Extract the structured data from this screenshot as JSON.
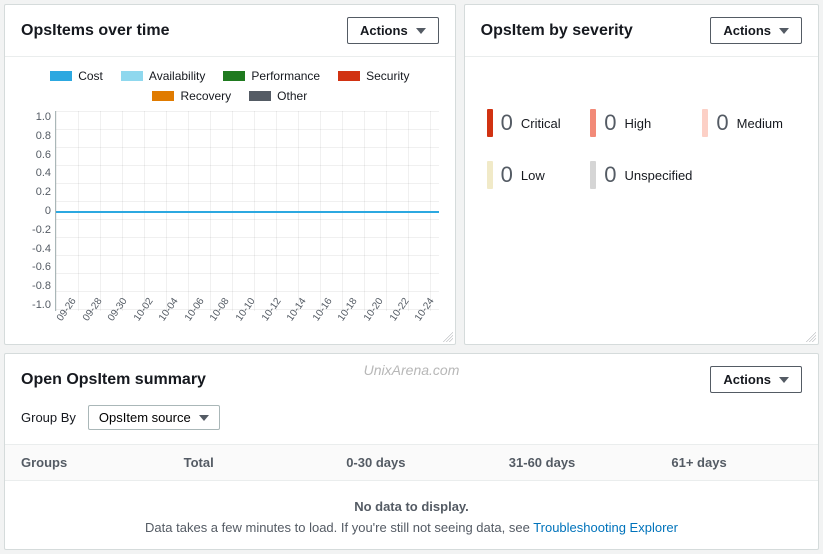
{
  "actions_label": "Actions",
  "watermark": "UnixArena.com",
  "chart_panel": {
    "title": "OpsItems over time",
    "legend": [
      {
        "label": "Cost",
        "color": "#2ca8e0"
      },
      {
        "label": "Availability",
        "color": "#8fd8ee"
      },
      {
        "label": "Performance",
        "color": "#1f7a1f"
      },
      {
        "label": "Security",
        "color": "#d13212"
      },
      {
        "label": "Recovery",
        "color": "#e07b00"
      },
      {
        "label": "Other",
        "color": "#545b64"
      }
    ]
  },
  "chart_data": {
    "type": "line",
    "title": "OpsItems over time",
    "xlabel": "",
    "ylabel": "",
    "ylim": [
      -1.0,
      1.0
    ],
    "y_ticks": [
      "1.0",
      "0.8",
      "0.6",
      "0.4",
      "0.2",
      "0",
      "-0.2",
      "-0.4",
      "-0.6",
      "-0.8",
      "-1.0"
    ],
    "categories": [
      "09-26",
      "09-28",
      "09-30",
      "10-02",
      "10-04",
      "10-06",
      "10-08",
      "10-10",
      "10-12",
      "10-14",
      "10-16",
      "10-18",
      "10-20",
      "10-22",
      "10-24"
    ],
    "series": [
      {
        "name": "Cost",
        "values": [
          0,
          0,
          0,
          0,
          0,
          0,
          0,
          0,
          0,
          0,
          0,
          0,
          0,
          0,
          0
        ]
      },
      {
        "name": "Availability",
        "values": [
          0,
          0,
          0,
          0,
          0,
          0,
          0,
          0,
          0,
          0,
          0,
          0,
          0,
          0,
          0
        ]
      },
      {
        "name": "Performance",
        "values": [
          0,
          0,
          0,
          0,
          0,
          0,
          0,
          0,
          0,
          0,
          0,
          0,
          0,
          0,
          0
        ]
      },
      {
        "name": "Security",
        "values": [
          0,
          0,
          0,
          0,
          0,
          0,
          0,
          0,
          0,
          0,
          0,
          0,
          0,
          0,
          0
        ]
      },
      {
        "name": "Recovery",
        "values": [
          0,
          0,
          0,
          0,
          0,
          0,
          0,
          0,
          0,
          0,
          0,
          0,
          0,
          0,
          0
        ]
      },
      {
        "name": "Other",
        "values": [
          0,
          0,
          0,
          0,
          0,
          0,
          0,
          0,
          0,
          0,
          0,
          0,
          0,
          0,
          0
        ]
      }
    ]
  },
  "severity_panel": {
    "title": "OpsItem by severity",
    "items": [
      {
        "label": "Critical",
        "count": 0,
        "color": "#d13212"
      },
      {
        "label": "High",
        "count": 0,
        "color": "#f28a78"
      },
      {
        "label": "Medium",
        "count": 0,
        "color": "#fcd0c6"
      },
      {
        "label": "Low",
        "count": 0,
        "color": "#f1eac8"
      },
      {
        "label": "Unspecified",
        "count": 0,
        "color": "#d5d5d5"
      }
    ]
  },
  "summary_panel": {
    "title": "Open OpsItem summary",
    "group_by_label": "Group By",
    "group_by_value": "OpsItem source",
    "columns": [
      "Groups",
      "Total",
      "0-30 days",
      "31-60 days",
      "61+ days"
    ],
    "empty_title": "No data to display.",
    "hint_prefix": "Data takes a few minutes to load. If you're still not seeing data, see ",
    "hint_link": "Troubleshooting Explorer"
  }
}
